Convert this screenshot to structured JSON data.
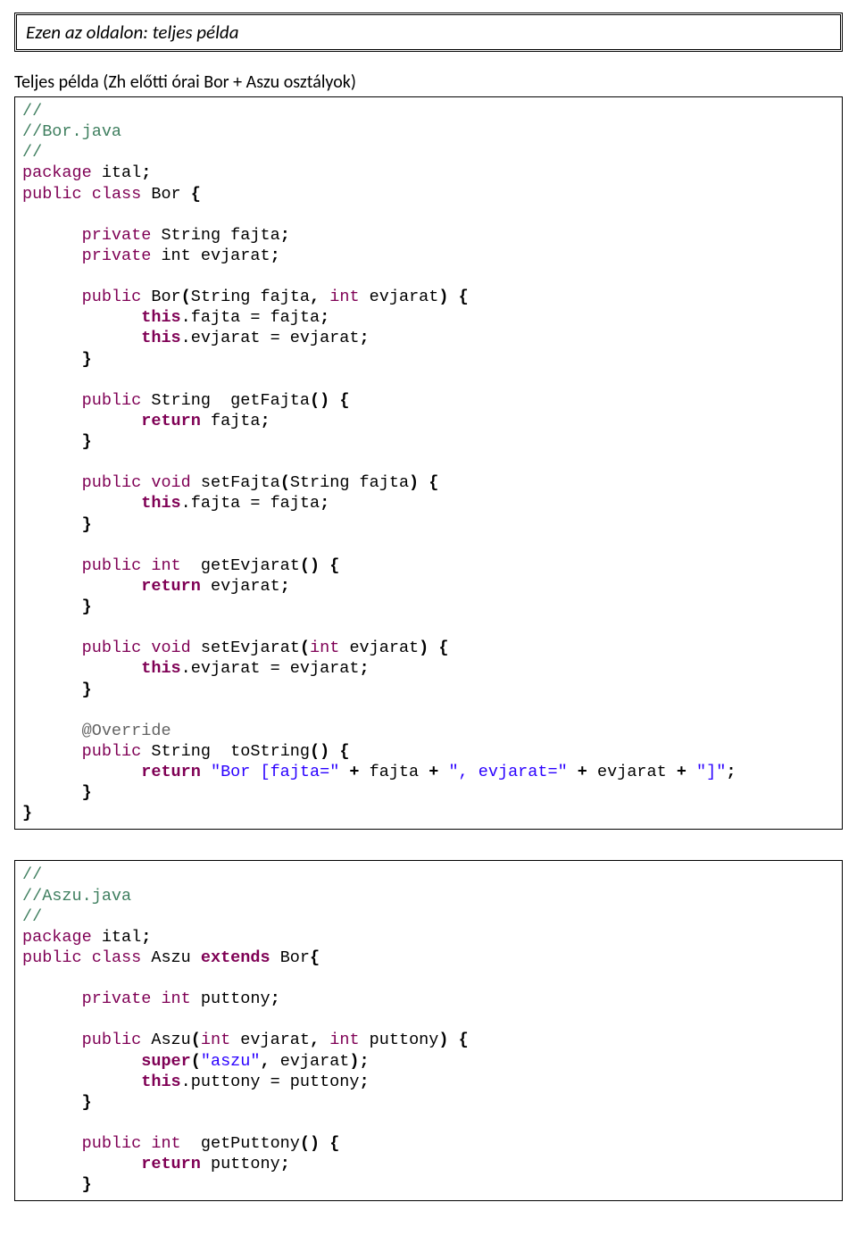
{
  "banner": "Ezen az oldalon: teljes példa",
  "section_title": "Teljes példa (Zh előtti órai Bor + Aszu osztályok)",
  "code1": {
    "c1": "//",
    "c2": "//Bor.java",
    "c3": "//",
    "pkg_kw": "package",
    "pkg_name": " ital",
    "pub": "public",
    "cls": "class",
    "cls_name": " Bor ",
    "priv": "private",
    "t_string": " String ",
    "f_fajta": "fajta",
    "t_int": " int ",
    "f_evjarat": "evjarat",
    "ctor_sig1": " Bor",
    "ctor_p1": "String ",
    "ctor_p1n": "fajta",
    "ctor_p2": "int ",
    "ctor_p2n": "evjarat",
    "this": "this",
    "asg_fajta": ".fajta = fajta",
    "asg_evj": ".evjarat = evjarat",
    "getFajta": " getFajta",
    "ret": "return",
    "ret_fajta": " fajta",
    "void": " void ",
    "setFajta": "setFajta",
    "getEvj": " getEvjarat",
    "ret_evj": " evjarat",
    "setEvj": "setEvjarat",
    "override": "@Override",
    "toStr": " toString",
    "s1": "\"Bor [fajta=\"",
    "plus_fajta": " fajta ",
    "s2": "\", evjarat=\"",
    "plus_evj": " evjarat ",
    "s3": "\"]\""
  },
  "code2": {
    "c1": "//",
    "c2": "//Aszu.java",
    "c3": "//",
    "pkg_kw": "package",
    "pkg_name": " ital",
    "pub": "public",
    "cls": "class",
    "cls_name": " Aszu ",
    "ext": "extends",
    "parent": " Bor",
    "priv": "private",
    "t_int": " int ",
    "f_put": "puttony",
    "ctor": " Aszu",
    "p1": "int ",
    "p1n": "evjarat",
    "p2": "int ",
    "p2n": "puttony",
    "super": "super",
    "s_aszu": "\"aszu\"",
    "s_evj": " evjarat",
    "this": "this",
    "asg_put": ".puttony = puttony",
    "getPut": " getPuttony",
    "ret": "return",
    "ret_put": " puttony"
  }
}
